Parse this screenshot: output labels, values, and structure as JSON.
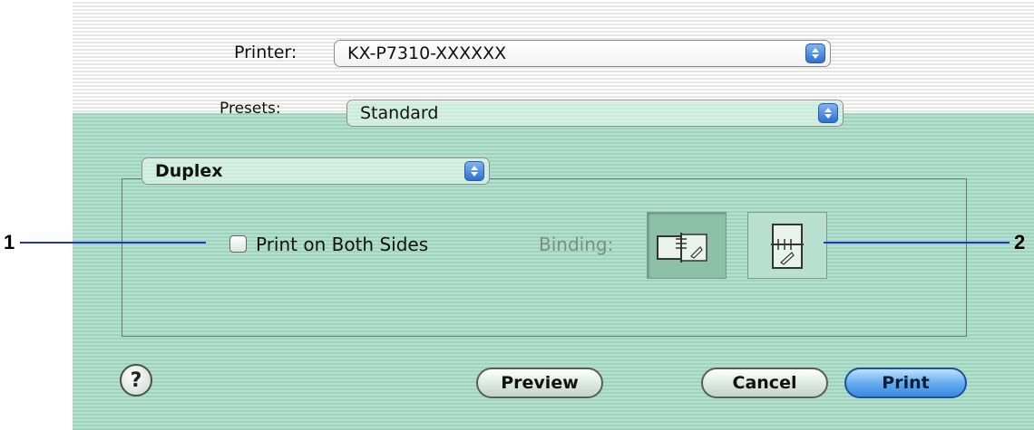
{
  "printer": {
    "label": "Printer:",
    "value": "KX-P7310-XXXXXX"
  },
  "presets": {
    "label": "Presets:",
    "value": "Standard"
  },
  "panel_selector": {
    "value": "Duplex"
  },
  "duplex": {
    "checkbox_label": "Print on Both Sides",
    "checked": false,
    "binding_label": "Binding:"
  },
  "callouts": {
    "left": "1",
    "right": "2"
  },
  "buttons": {
    "help": "?",
    "preview": "Preview",
    "cancel": "Cancel",
    "print": "Print"
  },
  "icons": {
    "popup_arrows": "up-down-arrows-icon",
    "binding_long_edge": "long-edge-binding-icon",
    "binding_short_edge": "short-edge-binding-icon"
  },
  "colors": {
    "sheet_green": "#9ed4bd",
    "accent_blue": "#3c88db",
    "callout_line": "#1f2fd6"
  }
}
